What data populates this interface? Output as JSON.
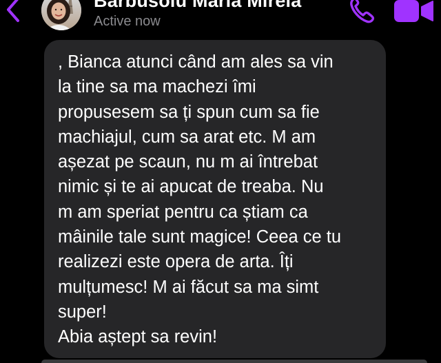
{
  "header": {
    "contact_name": "Barbusoiu Maria Mirela",
    "status": "Active now"
  },
  "icons": {
    "back": "chevron-left-icon",
    "call": "phone-icon",
    "video": "video-camera-icon"
  },
  "colors": {
    "accent": "#a033ff",
    "background": "#000000",
    "bubble": "#262628",
    "status_text": "#8a8a8e"
  },
  "message": {
    "text": ", Bianca atunci când am ales sa vin\nla tine sa ma machezi îmi\npropusesem sa ți spun cum sa fie\nmachiajul, cum sa arat etc. M am\nașezat pe scaun, nu m ai întrebat\nnimic și te ai apucat de treaba. Nu\nm am speriat pentru ca știam ca\nmâinile tale sunt magice! Ceea ce tu\nrealizezi este opera de arta.  Îți\nmulțumesc! M ai făcut sa ma simt\nsuper!\nAbia aștept sa revin!"
  }
}
